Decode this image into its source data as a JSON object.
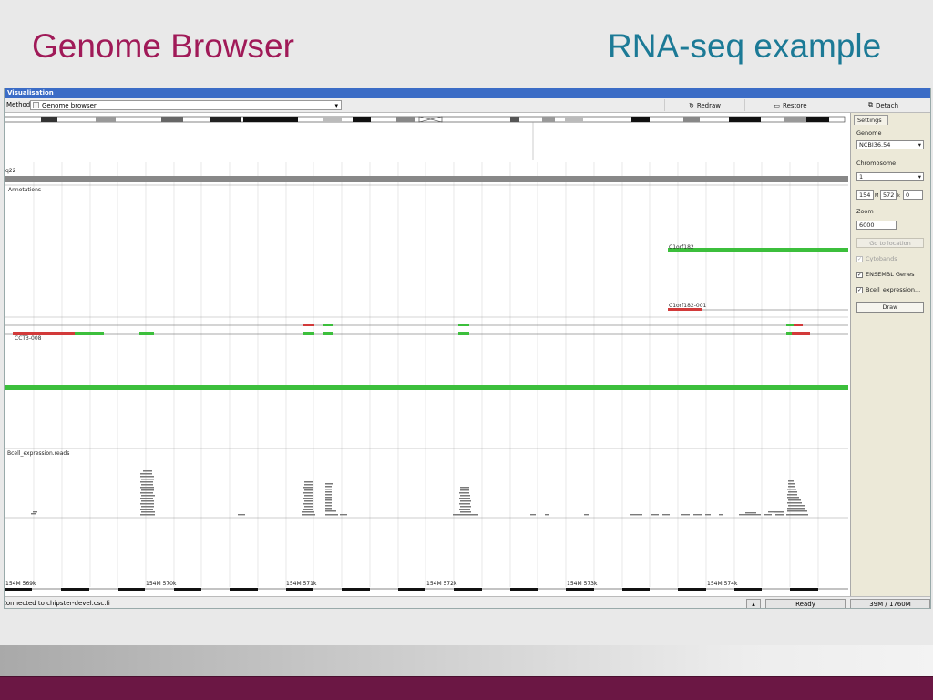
{
  "slide": {
    "title_left": "Genome Browser",
    "title_right": "RNA-seq example",
    "title_left_color": "#a01a58",
    "title_right_color": "#1c7a96",
    "footer_color": "#6b1744"
  },
  "window": {
    "title": "Visualisation"
  },
  "toolbar": {
    "method_label": "Method:",
    "method_value": "Genome browser",
    "redraw_label": "Redraw",
    "restore_label": "Restore",
    "detach_label": "Detach"
  },
  "browser": {
    "band_label": "q22",
    "annotations_label": "Annotations",
    "gene_label_1": "C1orf182",
    "gene_label_2": "C1orf182-001",
    "gene_label_3": "CCT3-008",
    "reads_label": "Bcell_expression.reads",
    "ruler_labels": [
      "154M 569k",
      "154M 570k",
      "154M 571k",
      "154M 572k",
      "154M 573k",
      "154M 574k"
    ]
  },
  "settings": {
    "tab_label": "Settings",
    "genome_label": "Genome",
    "genome_value": "NCBI36.54",
    "chromosome_label": "Chromosome",
    "chromosome_value": "1",
    "pos_m": "154",
    "pos_m_unit": "M",
    "pos_k": "572",
    "pos_k_unit": "k",
    "pos_rest": "0",
    "zoom_label": "Zoom",
    "zoom_value": "6000",
    "go_button": "Go to location",
    "check_cytobands": "Cytobands",
    "check_ensembl": "ENSEMBL Genes",
    "check_bcell": "Bcell_expression...",
    "draw_button": "Draw"
  },
  "status": {
    "connection": "Connected to chipster-devel.csc.fi",
    "ready": "Ready",
    "memory": "39M / 1760M"
  },
  "colors": {
    "exon_green": "#3cbf3c",
    "utr_red": "#d23a3a",
    "read_gray": "#7a7a7a",
    "titlebar_blue": "#3b6cc6"
  }
}
